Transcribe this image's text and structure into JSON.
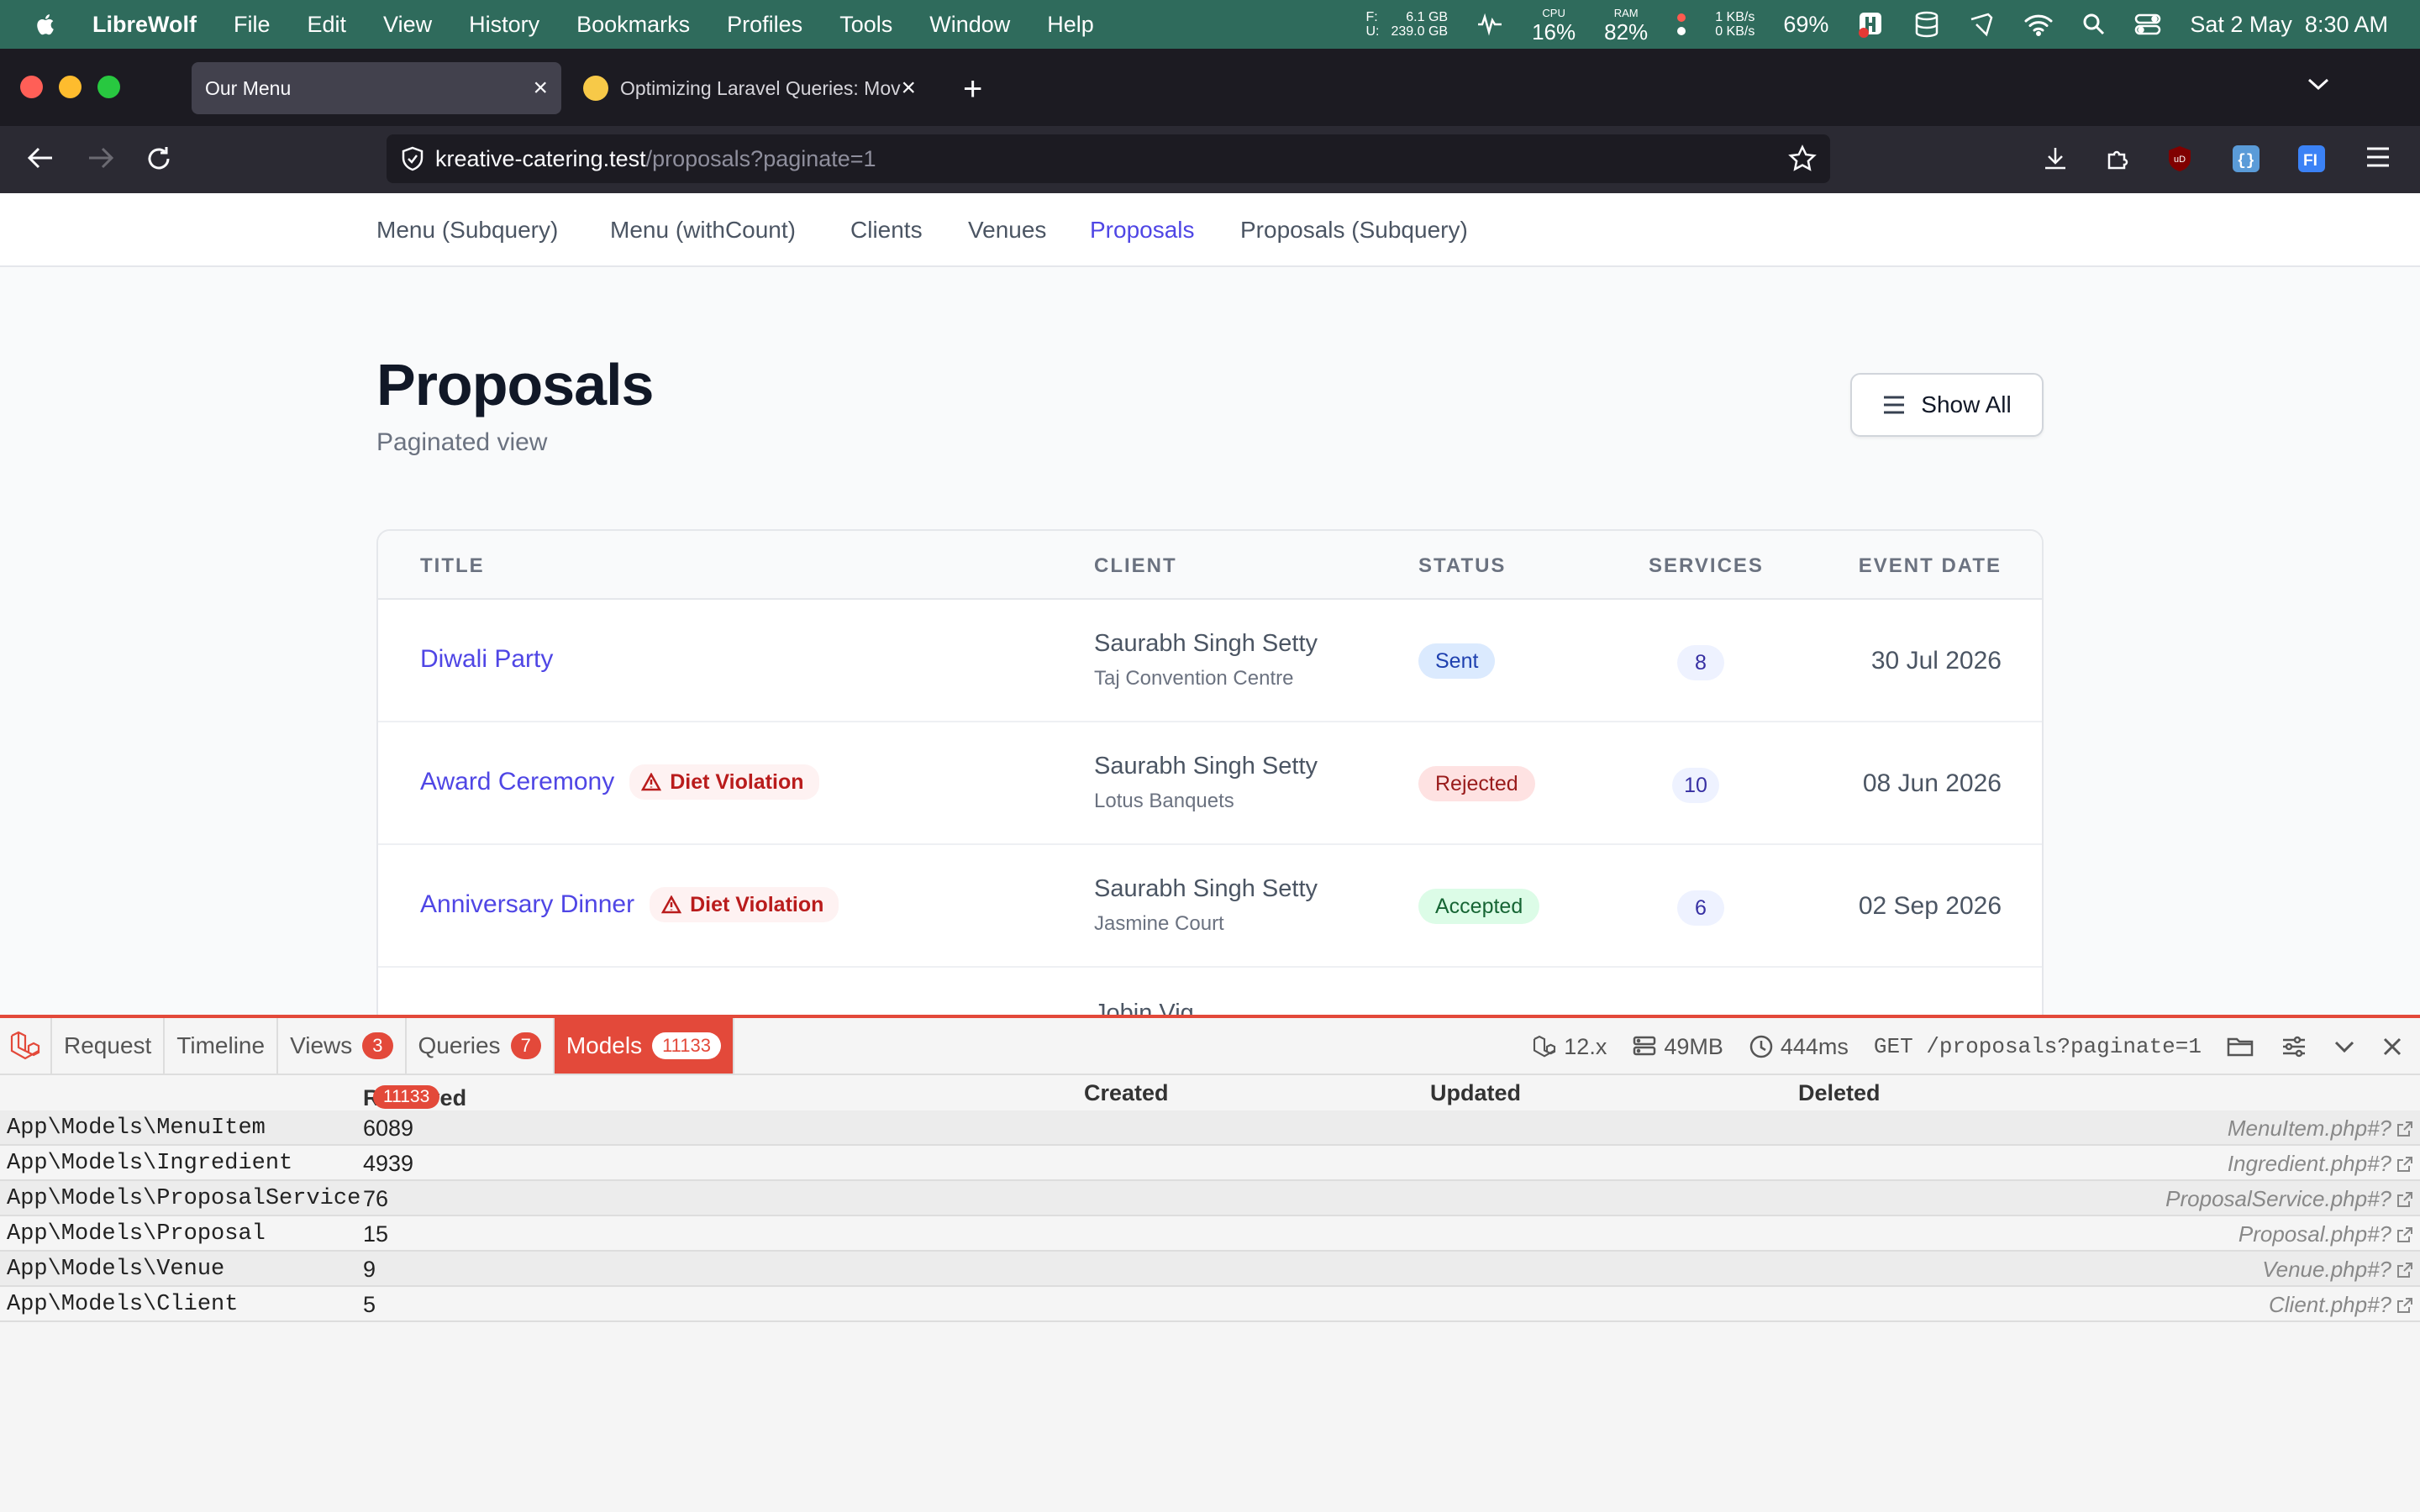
{
  "menubar": {
    "app": "LibreWolf",
    "items": [
      "File",
      "Edit",
      "View",
      "History",
      "Bookmarks",
      "Profiles",
      "Tools",
      "Window",
      "Help"
    ],
    "disk_f_label": "F:",
    "disk_u_label": "U:",
    "disk_f": "6.1 GB",
    "disk_u": "239.0 GB",
    "cpu_label": "CPU",
    "cpu": "16%",
    "ram_label": "RAM",
    "ram": "82%",
    "net_up": "1 KB/s",
    "net_down": "0 KB/s",
    "battery": "69%",
    "datetime": "Sat 2 May  8:30 AM"
  },
  "browser": {
    "tabs": [
      {
        "title": "Our Menu",
        "active": true
      },
      {
        "title": "Optimizing Laravel Queries: Mov",
        "active": false
      }
    ],
    "url_host": "kreative-catering.test",
    "url_path": "/proposals?paginate=1"
  },
  "nav": {
    "items": [
      "Menu (Subquery)",
      "Menu (withCount)",
      "Clients",
      "Venues",
      "Proposals",
      "Proposals (Subquery)"
    ],
    "active": "Proposals"
  },
  "page": {
    "title": "Proposals",
    "subtitle": "Paginated view",
    "show_all": "Show All"
  },
  "table": {
    "headers": [
      "TITLE",
      "CLIENT",
      "STATUS",
      "SERVICES",
      "EVENT DATE"
    ],
    "rows": [
      {
        "title": "Diwali Party",
        "violation": "",
        "client": "Saurabh Singh Setty",
        "venue": "Taj Convention Centre",
        "status": "Sent",
        "services": "8",
        "date": "30 Jul 2026"
      },
      {
        "title": "Award Ceremony",
        "violation": "Diet Violation",
        "client": "Saurabh Singh Setty",
        "venue": "Lotus Banquets",
        "status": "Rejected",
        "services": "10",
        "date": "08 Jun 2026"
      },
      {
        "title": "Anniversary Dinner",
        "violation": "Diet Violation",
        "client": "Saurabh Singh Setty",
        "venue": "Jasmine Court",
        "status": "Accepted",
        "services": "6",
        "date": "02 Sep 2026"
      },
      {
        "client_partial": "Jobin Vig"
      }
    ]
  },
  "colors": {
    "accent": "#4f46e5",
    "debugbar_red": "#e3493a",
    "menubar_bg": "#2f6b5c"
  },
  "debugbar": {
    "tabs": [
      {
        "label": "Request",
        "badge": ""
      },
      {
        "label": "Timeline",
        "badge": ""
      },
      {
        "label": "Views",
        "badge": "3"
      },
      {
        "label": "Queries",
        "badge": "7"
      },
      {
        "label": "Models",
        "badge": "11133"
      }
    ],
    "active_tab": "Models",
    "version": "12.x",
    "memory": "49MB",
    "time": "444ms",
    "request": "GET /proposals?paginate=1",
    "models": {
      "headers": {
        "retrieved": "Retrieved",
        "retrieved_badge": "11133",
        "created": "Created",
        "updated": "Updated",
        "deleted": "Deleted"
      },
      "rows": [
        {
          "name": "App\\Models\\MenuItem",
          "retrieved": "6089",
          "file": "MenuItem.php#?"
        },
        {
          "name": "App\\Models\\Ingredient",
          "retrieved": "4939",
          "file": "Ingredient.php#?"
        },
        {
          "name": "App\\Models\\ProposalService",
          "retrieved": "76",
          "file": "ProposalService.php#?"
        },
        {
          "name": "App\\Models\\Proposal",
          "retrieved": "15",
          "file": "Proposal.php#?"
        },
        {
          "name": "App\\Models\\Venue",
          "retrieved": "9",
          "file": "Venue.php#?"
        },
        {
          "name": "App\\Models\\Client",
          "retrieved": "5",
          "file": "Client.php#?"
        }
      ]
    }
  }
}
